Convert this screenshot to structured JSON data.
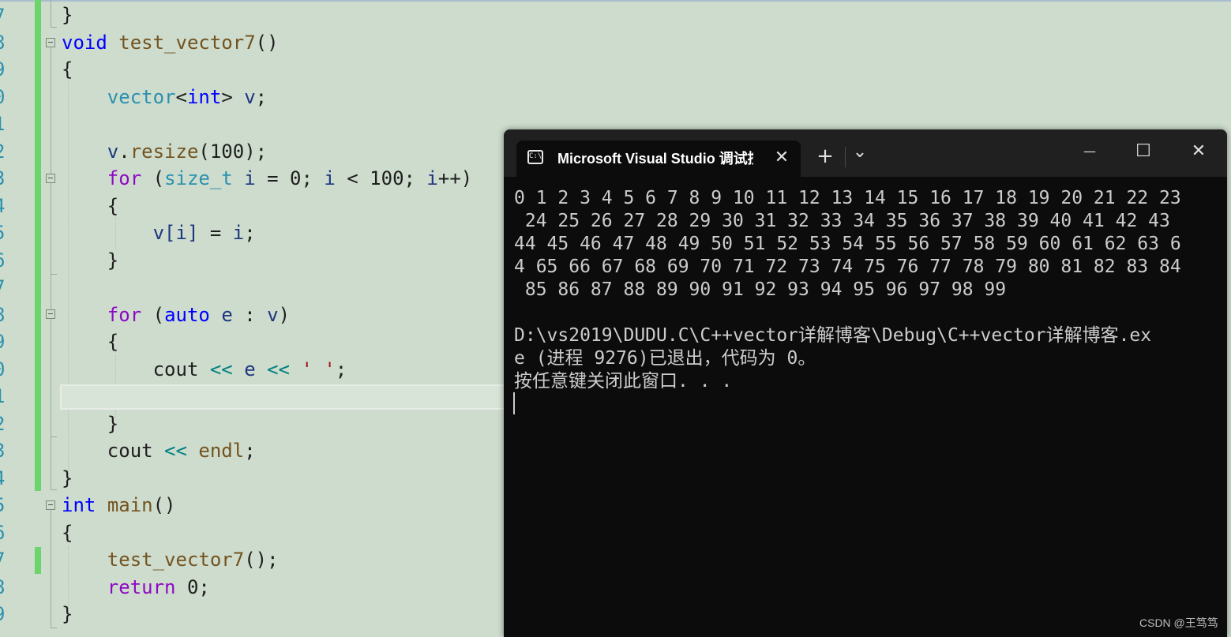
{
  "editor": {
    "line_numbers": [
      "7",
      "8",
      "9",
      "0",
      "1",
      "2",
      "3",
      "4",
      "5",
      "6",
      "7",
      "8",
      "9",
      "0",
      "1",
      "2",
      "3",
      "4",
      "5",
      "6",
      "7",
      "8",
      "9"
    ],
    "code": {
      "l1": "}",
      "l2_kw": "void",
      "l2_fn": "test_vector7",
      "l2_rest": "()",
      "l3": "{",
      "l4_ty": "vector",
      "l4_lt": "<",
      "l4_kw": "int",
      "l4_gt": ">",
      "l4_var": "v",
      "l4_semi": ";",
      "l6_var": "v",
      "l6_dot": ".",
      "l6_fn": "resize",
      "l6_rest": "(100);",
      "l7_kw": "for",
      "l7_p1": " (",
      "l7_ty": "size_t",
      "l7_sp": " ",
      "l7_i1": "i",
      "l7_m1": " = 0; ",
      "l7_i2": "i",
      "l7_m2": " < 100; ",
      "l7_i3": "i",
      "l7_m3": "++)",
      "l8": "{",
      "l9_var": "v",
      "l9_b1": "[",
      "l9_i": "i",
      "l9_b2": "]",
      "l9_eq": " = ",
      "l9_i2": "i",
      "l9_semi": ";",
      "l10": "}",
      "l12_kw": "for",
      "l12_p": " (",
      "l12_auto": "auto",
      "l12_sp": " ",
      "l12_e": "e",
      "l12_col": " : ",
      "l12_v": "v",
      "l12_end": ")",
      "l13": "{",
      "l14_cout": "cout",
      "l14_op1": " << ",
      "l14_e": "e",
      "l14_op2": " << ",
      "l14_str": "' '",
      "l14_semi": ";",
      "l16": "}",
      "l17_cout": "cout",
      "l17_op": " << ",
      "l17_endl": "endl",
      "l17_semi": ";",
      "l18": "}",
      "l19_kw": "int",
      "l19_fn": "main",
      "l19_rest": "()",
      "l20": "{",
      "l21_fn": "test_vector7",
      "l21_rest": "();",
      "l22_kw": "return",
      "l22_rest": " 0;",
      "l23": "}"
    }
  },
  "terminal": {
    "tab_title": "Microsoft Visual Studio 调试控制台",
    "icon_text": "C:\\",
    "tab_close": "✕",
    "new_tab": "+",
    "dropdown": "⌄",
    "minimize": "—",
    "maximize": "☐",
    "close": "✕",
    "output": "0 1 2 3 4 5 6 7 8 9 10 11 12 13 14 15 16 17 18 19 20 21 22 23\n 24 25 26 27 28 29 30 31 32 33 34 35 36 37 38 39 40 41 42 43\n44 45 46 47 48 49 50 51 52 53 54 55 56 57 58 59 60 61 62 63 6\n4 65 66 67 68 69 70 71 72 73 74 75 76 77 78 79 80 81 82 83 84\n 85 86 87 88 89 90 91 92 93 94 95 96 97 98 99\n\nD:\\vs2019\\DUDU.C\\C++vector详解博客\\Debug\\C++vector详解博客.ex\ne (进程 9276)已退出，代码为 0。\n按任意键关闭此窗口. . ."
  },
  "watermark": "CSDN @王笃笃"
}
